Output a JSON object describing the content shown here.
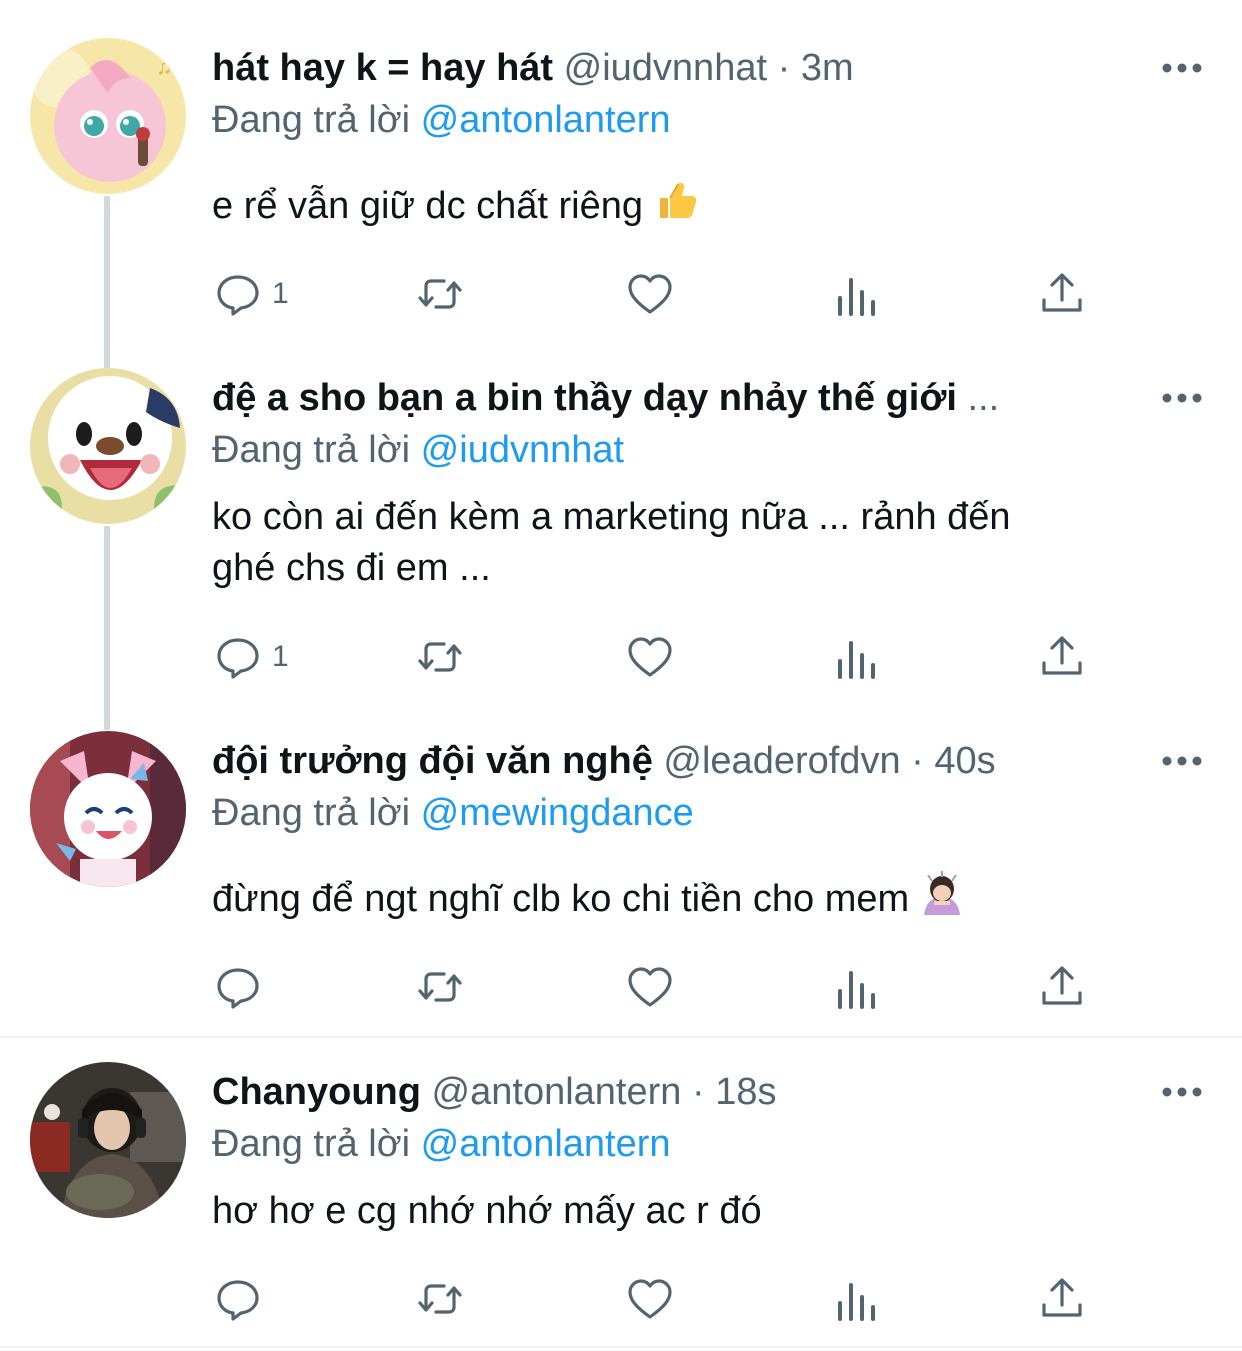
{
  "tweets": [
    {
      "name": "hát hay k = hay hát",
      "handle": "@iudvnnhat",
      "separator": "·",
      "time": "3m",
      "reply_prefix": "Đang trả lời",
      "reply_to": "@antonlantern",
      "body_lines": [
        "e rể vẫn giữ dc chất riêng"
      ],
      "emoji": "thumbs-up",
      "reply_count": "1",
      "avatar_icon": "jigglypuff-avatar"
    },
    {
      "name": "đệ a sho bạn a bin thầy dạy nhảy thế giới",
      "name_ellipsis": "...",
      "reply_prefix": "Đang trả lời",
      "reply_to": "@iudvnnhat",
      "body_lines": [
        "ko còn ai đến kèm a marketing nữa ... rảnh đến",
        "ghé chs đi em ..."
      ],
      "reply_count": "1",
      "avatar_icon": "oshawott-avatar"
    },
    {
      "name": "đội trưởng đội văn nghệ",
      "handle": "@leaderofdvn",
      "separator": "·",
      "time": "40s",
      "reply_prefix": "Đang trả lời",
      "reply_to": "@mewingdance",
      "body_lines": [
        "đừng để ngt nghĩ clb ko chi tiền cho mem"
      ],
      "emoji": "person-bowing",
      "reply_count": "",
      "avatar_icon": "sylveon-avatar"
    },
    {
      "name": "Chanyoung",
      "handle": "@antonlantern",
      "separator": "·",
      "time": "18s",
      "reply_prefix": "Đang trả lời",
      "reply_to": "@antonlantern",
      "body_lines": [
        "hơ hơ e cg nhớ nhớ mấy ac r đó"
      ],
      "reply_count": "",
      "avatar_icon": "person-photo-avatar"
    }
  ],
  "colors": {
    "text": "#0f1419",
    "secondary": "#536471",
    "link": "#1d9bf0",
    "thread_line": "#cfd9de",
    "divider": "#eff3f4"
  },
  "icons": [
    "reply-icon",
    "retweet-icon",
    "like-icon",
    "views-icon",
    "share-icon",
    "more-icon"
  ]
}
